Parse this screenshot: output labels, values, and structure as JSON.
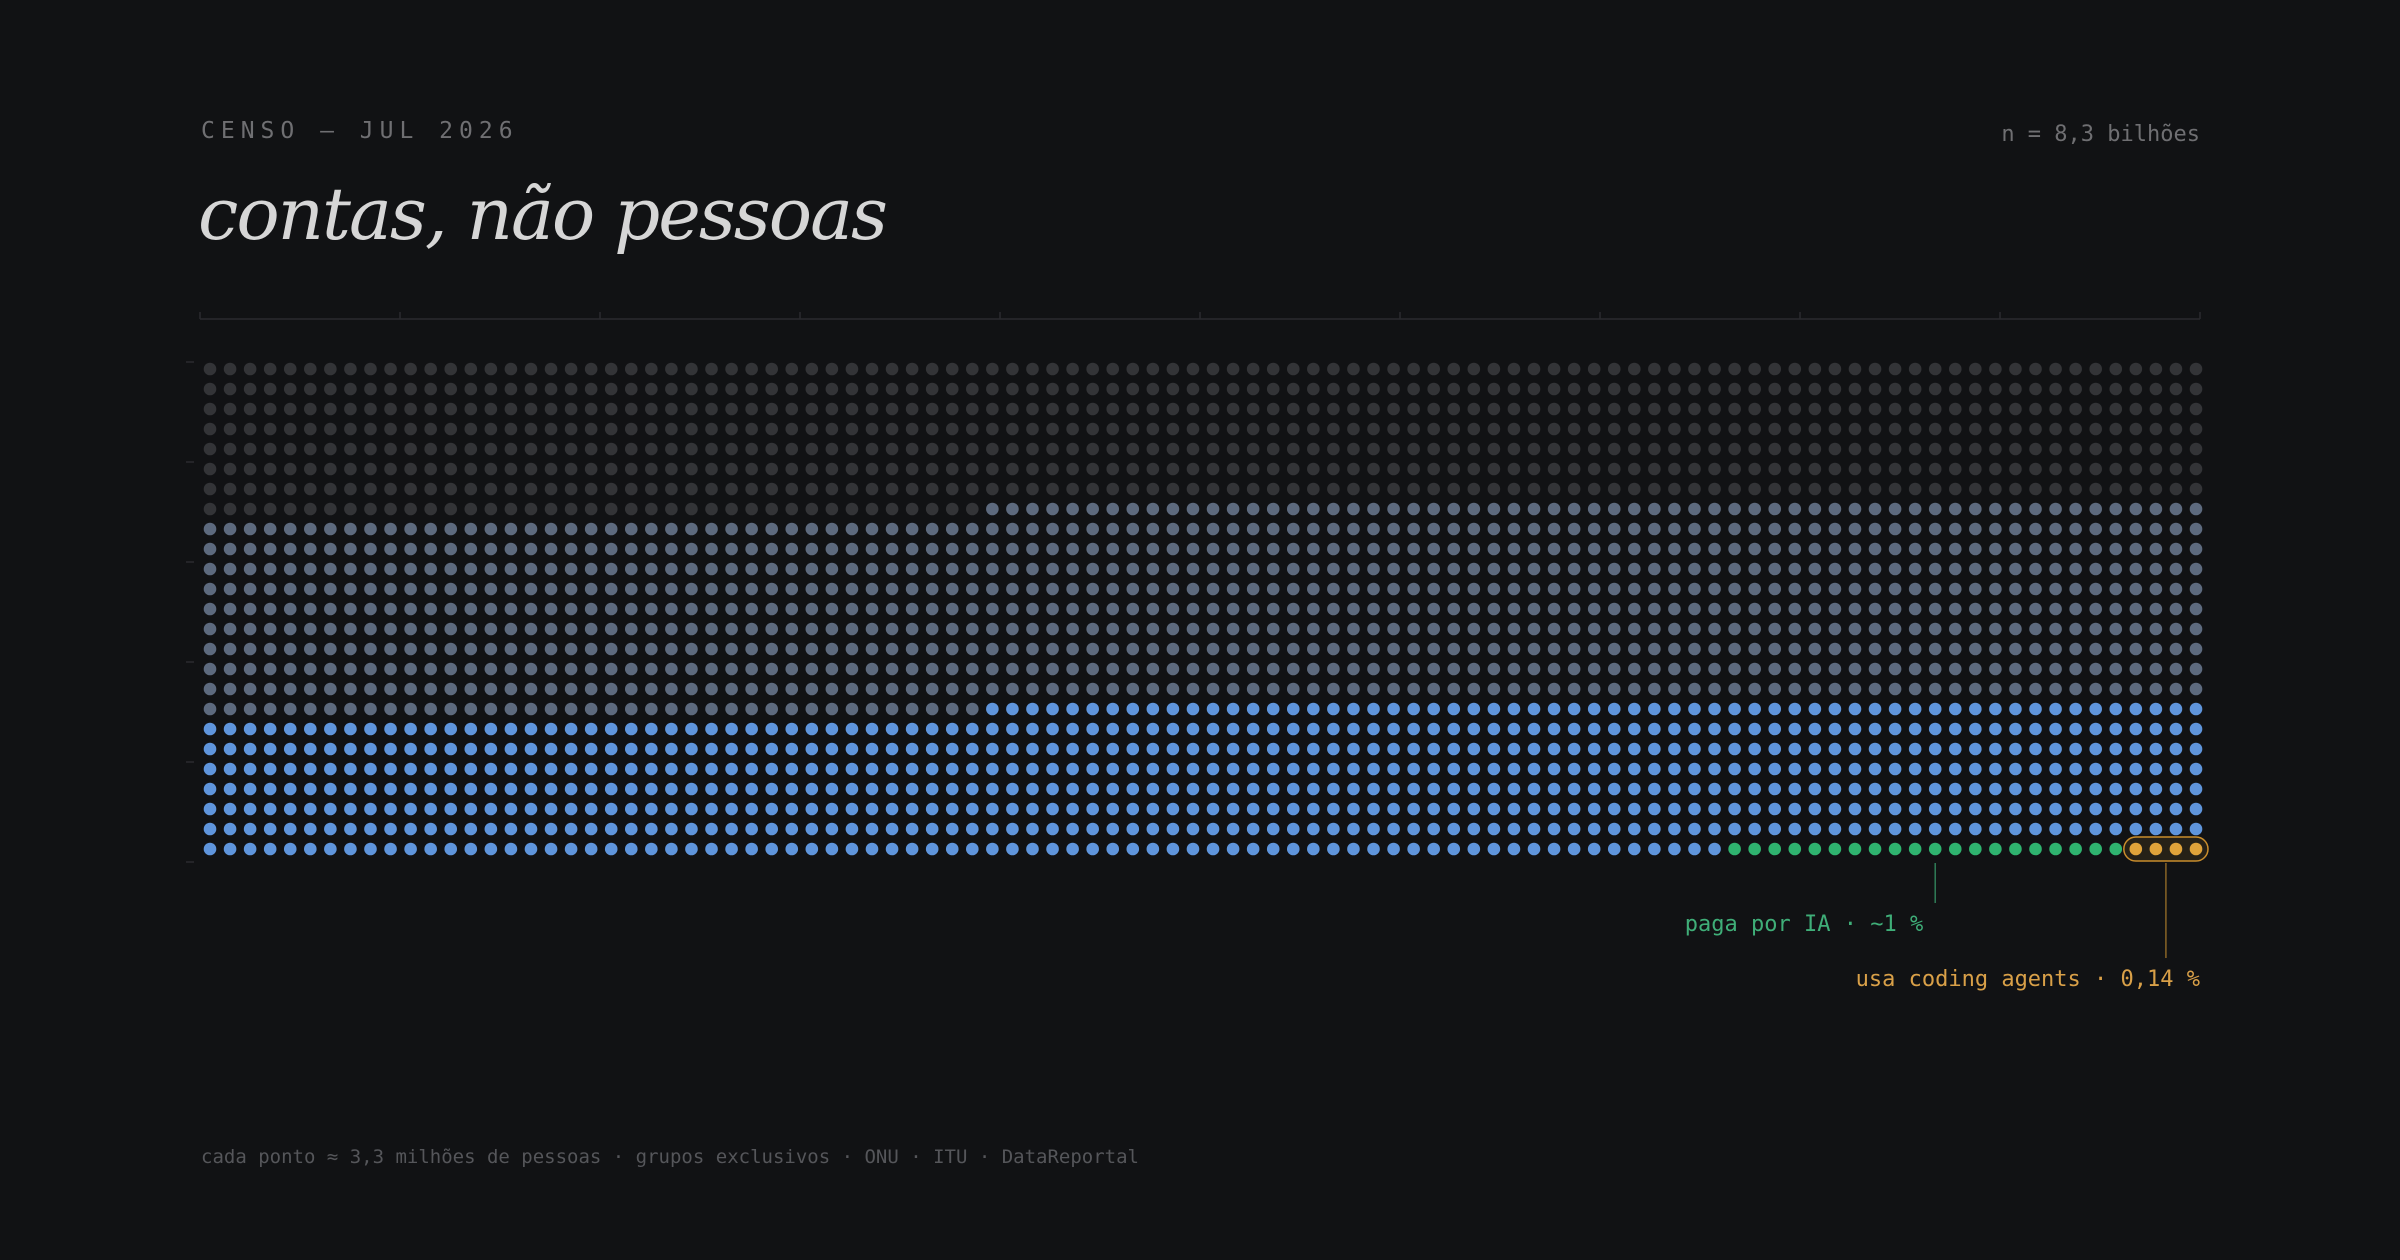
{
  "header": {
    "kicker": "CENSO — JUL 2026",
    "count": "n = 8,3 bilhões",
    "title": "contas, não pessoas"
  },
  "footer": {
    "note": "cada ponto ≈ 3,3 milhões de pessoas · grupos exclusivos · ONU · ITU · DataReportal"
  },
  "chart_data": {
    "type": "waffle",
    "total_population_billions": 8.3,
    "people_per_dot_millions": 3.3,
    "grid": {
      "columns": 100,
      "rows": 25
    },
    "fill_order": "bottom-up, left-to-right",
    "groups": [
      {
        "key": "coding_agents",
        "dots": 4,
        "color": "#e0a33a",
        "label": "usa coding agents · 0,14 %"
      },
      {
        "key": "pays_ai",
        "dots": 20,
        "color": "#2fb36f",
        "label": "paga por IA · ~1 %"
      },
      {
        "key": "group_blue",
        "dots": 737,
        "color": "#5f95dc"
      },
      {
        "key": "group_slate",
        "dots": 1000,
        "color": "#5d6a7e"
      },
      {
        "key": "group_dark",
        "dots": 739,
        "color": "#333437"
      }
    ],
    "colors": {
      "background": "#111214",
      "green_text": "#3fae78",
      "amber_text": "#d9a048"
    }
  }
}
